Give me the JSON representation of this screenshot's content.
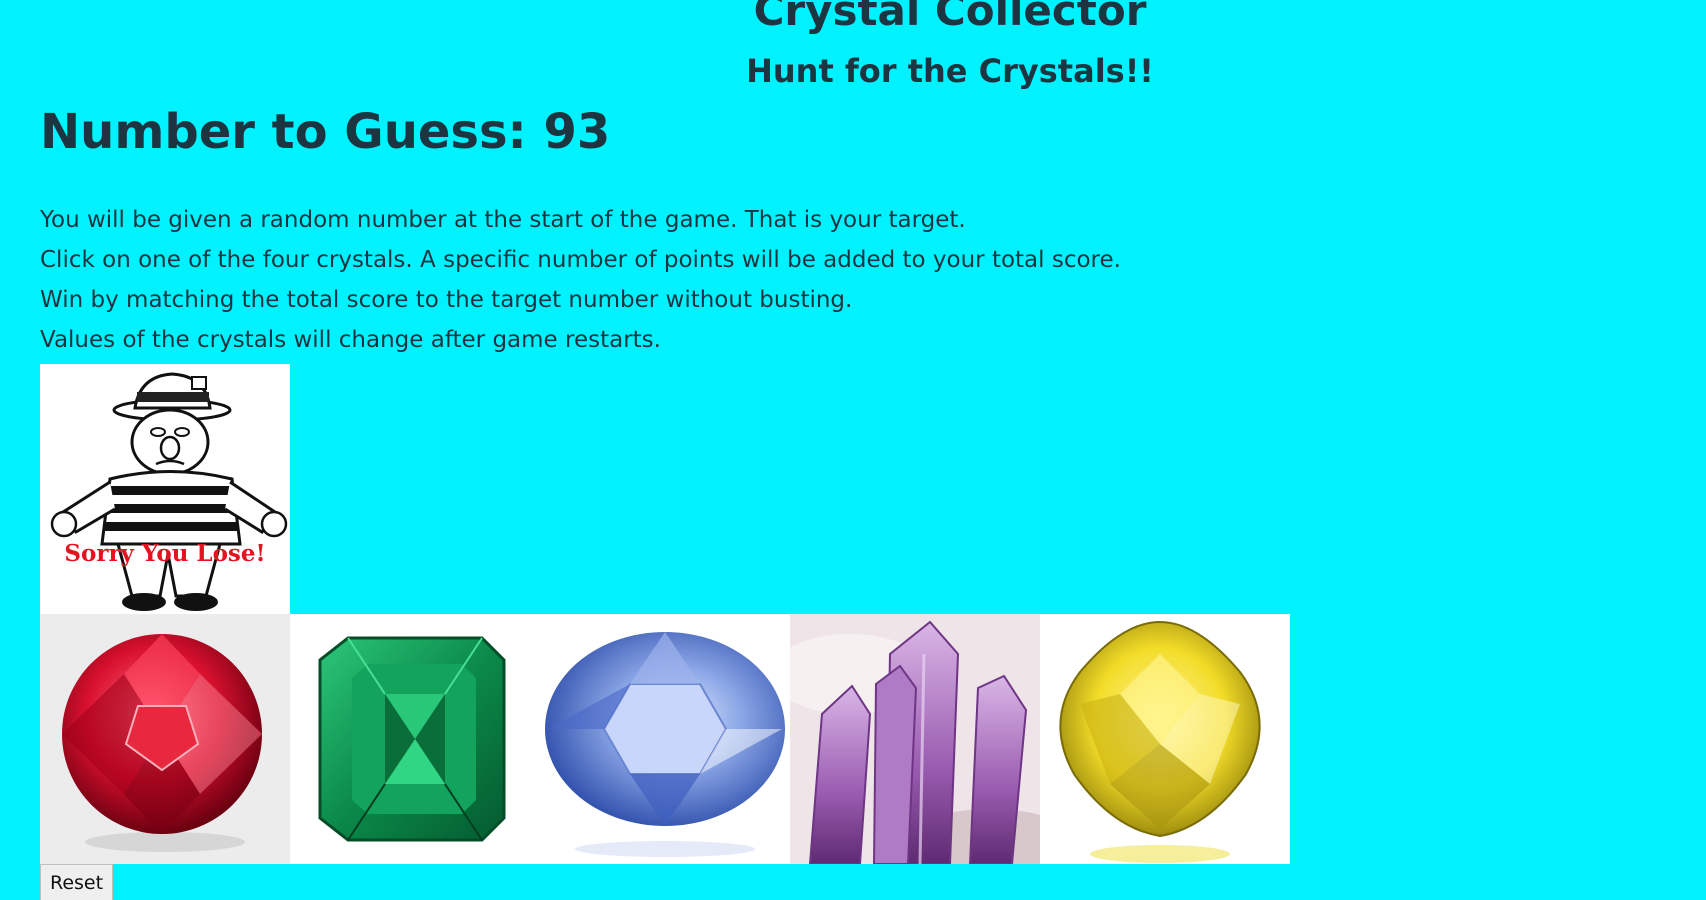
{
  "header": {
    "title": "Crystal Collector",
    "subtitle": "Hunt for the Crystals!!"
  },
  "game": {
    "target_label": "Number to Guess: 93"
  },
  "instructions": [
    "You will be given a random number at the start of the game. That is your target.",
    "Click on one of the four crystals. A specific number of points will be added to your total score.",
    "Win by matching the total score to the target number without busting.",
    "Values of the crystals will change after game restarts."
  ],
  "status_image": {
    "caption": "Sorry You Lose!",
    "icon": "sad-man-lose-icon"
  },
  "crystals": [
    {
      "name": "ruby",
      "color": "#e0203c"
    },
    {
      "name": "emerald",
      "color": "#0f9a55"
    },
    {
      "name": "sapphire",
      "color": "#6f8fd8"
    },
    {
      "name": "amethyst",
      "color": "#9a5cb0"
    },
    {
      "name": "yellow-diamond",
      "color": "#f2dc28"
    }
  ],
  "controls": {
    "reset_label": "Reset"
  }
}
